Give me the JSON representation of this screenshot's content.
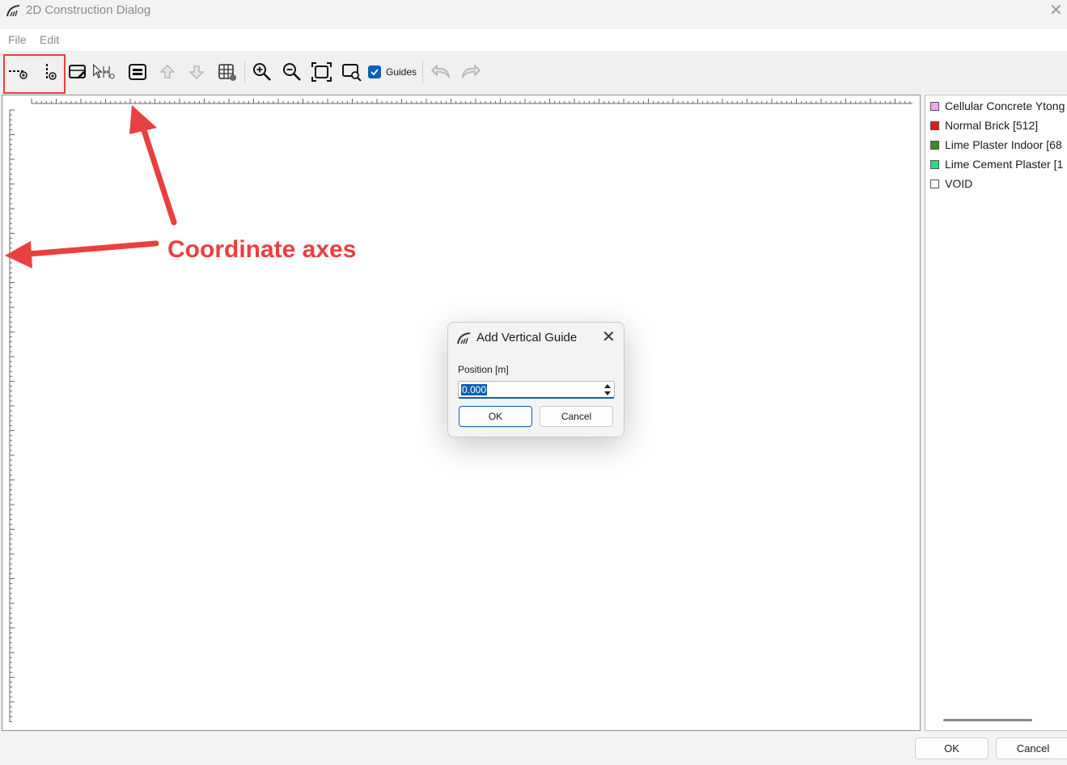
{
  "window": {
    "title": "2D Construction Dialog"
  },
  "menu": [
    "File",
    "Edit"
  ],
  "toolbar": {
    "guides_label": "Guides",
    "guides_checked": true
  },
  "legend": [
    {
      "label": "Cellular Concrete Ytong",
      "color": "#f4a6ef"
    },
    {
      "label": "Normal Brick [512]",
      "color": "#e21a1a"
    },
    {
      "label": "Lime Plaster Indoor [68",
      "color": "#3c8a2b"
    },
    {
      "label": "Lime Cement Plaster [1",
      "color": "#22e089"
    },
    {
      "label": "VOID",
      "color": "#ffffff"
    }
  ],
  "annotation": {
    "text": "Coordinate axes",
    "color": "#e8403f"
  },
  "dialog": {
    "title": "Add Vertical Guide",
    "field_label": "Position [m]",
    "value": "0.000",
    "ok": "OK",
    "cancel": "Cancel"
  },
  "footer": {
    "ok": "OK",
    "cancel": "Cancel"
  }
}
